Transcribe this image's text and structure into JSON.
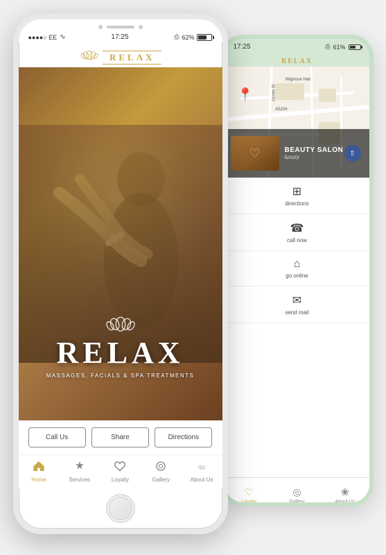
{
  "app": {
    "name": "RELAX",
    "tagline": "MASSAGES, FACIALS & SPA TREATMENTS"
  },
  "phone_front": {
    "status": {
      "carrier": "●●●●○ EE",
      "wifi": "WiFi",
      "time": "17:25",
      "bluetooth": "BT",
      "battery_pct": "62%"
    },
    "logo": "RELAX",
    "hero": {
      "lotus_symbol": "✿",
      "brand": "RELAX",
      "subtitle": "MASSAGES, FACIALS & SPA TREATMENTS"
    },
    "buttons": {
      "call": "Call Us",
      "share": "Share",
      "directions": "Directions"
    },
    "nav": [
      {
        "id": "home",
        "label": "Home",
        "icon": "⌂",
        "active": true
      },
      {
        "id": "services",
        "label": "Services",
        "icon": "✦",
        "active": false
      },
      {
        "id": "loyalty",
        "label": "Loyalty",
        "icon": "♡",
        "active": false
      },
      {
        "id": "gallery",
        "label": "Gallery",
        "icon": "◎",
        "active": false
      },
      {
        "id": "about",
        "label": "About Us",
        "icon": "❀",
        "active": false
      }
    ]
  },
  "phone_back": {
    "status": {
      "time": "17:25",
      "bluetooth": "BT",
      "battery_pct": "61%"
    },
    "map": {
      "labels": [
        "A5204",
        "Wigmore Hall",
        "James St"
      ]
    },
    "business": {
      "name": "BEAUTY SALON",
      "subtitle": "luxury"
    },
    "actions": [
      {
        "id": "directions",
        "label": "directions",
        "icon": "⊞"
      },
      {
        "id": "call",
        "label": "call now",
        "icon": "☎"
      },
      {
        "id": "online",
        "label": "go online",
        "icon": "⌂"
      },
      {
        "id": "mail",
        "label": "send mail",
        "icon": "✉"
      }
    ],
    "tabs": [
      {
        "id": "loyalty",
        "label": "Loyalty",
        "icon": "♡",
        "active": true
      },
      {
        "id": "gallery",
        "label": "Gallery",
        "icon": "◎",
        "active": false
      },
      {
        "id": "about",
        "label": "About Us",
        "icon": "❀",
        "active": false
      }
    ]
  },
  "colors": {
    "gold": "#c8a84b",
    "dark_brown": "#6B4020",
    "white": "#ffffff",
    "light_gray": "#f0f0f0"
  }
}
